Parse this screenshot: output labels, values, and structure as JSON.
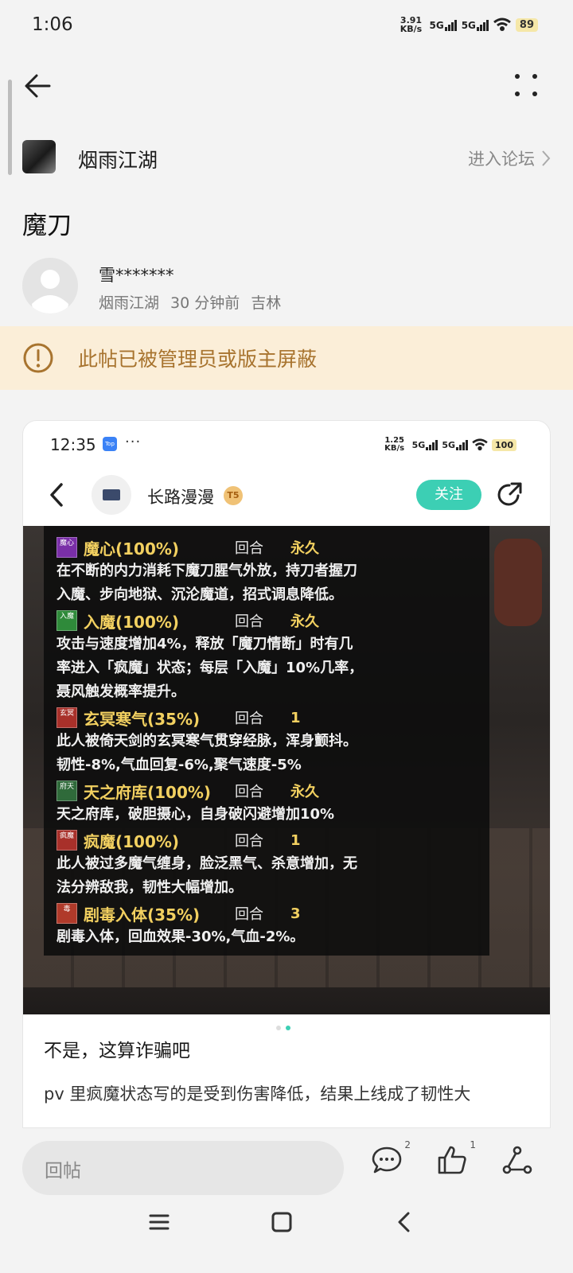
{
  "status_bar": {
    "time": "1:06",
    "net_speed": "3.91 KB/s",
    "net_speed_line1": "3.91",
    "net_speed_line2": "KB/s",
    "signal1": "5G",
    "signal2": "5G",
    "battery": "89"
  },
  "forum": {
    "name": "烟雨江湖",
    "enter_label": "进入论坛"
  },
  "post": {
    "title": "魔刀",
    "author": "雪*******",
    "meta_forum": "烟雨江湖",
    "meta_time": "30 分钟前",
    "meta_location": "吉林"
  },
  "banner": {
    "text": "此帖已被管理员或版主屏蔽"
  },
  "screenshot": {
    "status": {
      "time": "12:35",
      "app_badge": "Top",
      "dots": "···",
      "net_line1": "1.25",
      "net_line2": "KB/s",
      "signal1": "5G",
      "signal2": "5G",
      "battery": "100"
    },
    "nav": {
      "name": "长路漫漫",
      "level": "T5",
      "follow": "关注"
    },
    "round_label": "回合",
    "effects": [
      {
        "badge": "魔心",
        "name": "魔心(100%)",
        "duration": "永久",
        "color": "#7a2fa8",
        "desc": [
          "在不断的内力消耗下魔刀腥气外放，持刀者握刀",
          "入魔、步向地狱、沉沦魔道，招式调息降低。"
        ]
      },
      {
        "badge": "入魔",
        "name": "入魔(100%)",
        "duration": "永久",
        "color": "#2f8a3a",
        "desc": [
          "攻击与速度增加4%，释放「魔刀情断」时有几",
          "率进入「疯魔」状态；每层「入魔」10%几率，",
          "聂风触发概率提升。"
        ]
      },
      {
        "badge": "玄冥",
        "name": "玄冥寒气(35%)",
        "duration": "1",
        "color": "#a8302a",
        "desc": [
          "此人被倚天剑的玄冥寒气贯穿经脉，浑身颤抖。",
          "韧性-8%,气血回复-6%,聚气速度-5%"
        ]
      },
      {
        "badge": "府天",
        "name": "天之府库(100%)",
        "duration": "永久",
        "color": "#2f6a3a",
        "desc": [
          "天之府库，破胆摄心，自身破闪避增加10%"
        ]
      },
      {
        "badge": "疯魔",
        "name": "疯魔(100%)",
        "duration": "1",
        "color": "#a8302a",
        "desc": [
          "此人被过多魔气缠身，脸泛黑气、杀意增加，无",
          "法分辨敌我，韧性大幅增加。"
        ]
      },
      {
        "badge": "毒",
        "name": "剧毒入体(35%)",
        "duration": "3",
        "color": "#b03a2a",
        "desc": [
          "剧毒入体，回血效果-30%,气血-2%。"
        ]
      }
    ]
  },
  "content": {
    "line1": "不是，这算诈骗吧",
    "line2": "pv 里疯魔状态写的是受到伤害降低，结果上线成了韧性大"
  },
  "bottom": {
    "reply_placeholder": "回帖",
    "comment_count": "2",
    "like_count": "1"
  },
  "icons": [
    "back-icon",
    "more-icon",
    "chevron-right-icon",
    "warning-icon",
    "share-icon",
    "comment-icon",
    "like-icon",
    "share-link-icon",
    "menu-icon",
    "home-icon",
    "nav-back-icon"
  ]
}
